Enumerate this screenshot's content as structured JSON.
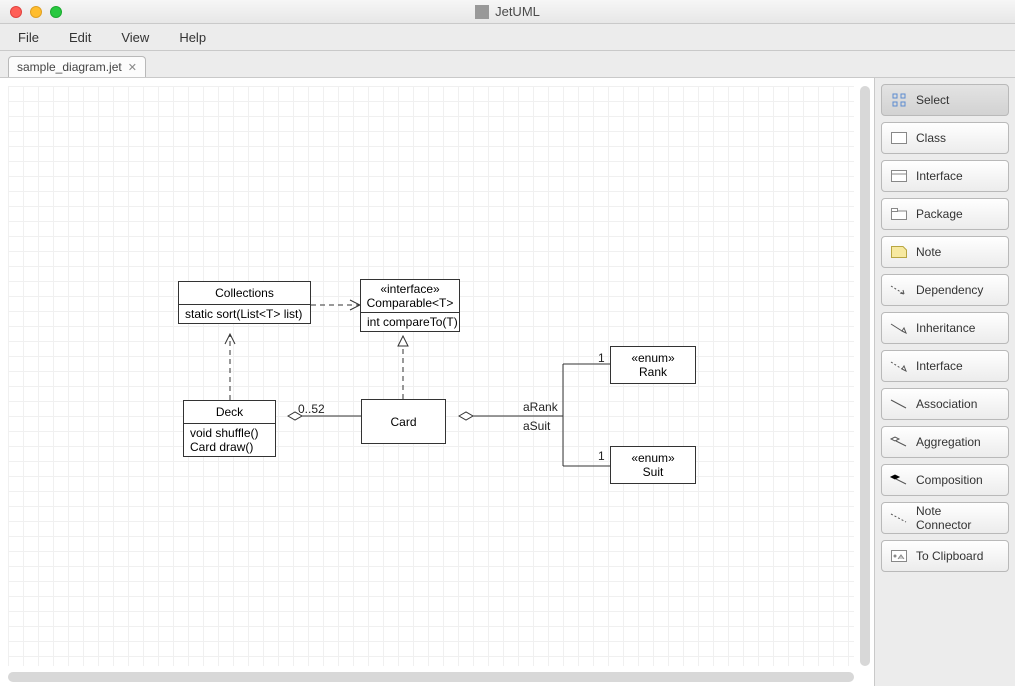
{
  "app_title": "JetUML",
  "menubar": {
    "file": "File",
    "edit": "Edit",
    "view": "View",
    "help": "Help"
  },
  "tab": {
    "label": "sample_diagram.jet",
    "close": "✕"
  },
  "nodes": {
    "collections": {
      "name": "Collections",
      "op": "static sort(List<T> list)"
    },
    "comparable": {
      "stereo": "«interface»",
      "name": "Comparable<T>",
      "op": "int compareTo(T)"
    },
    "deck": {
      "name": "Deck",
      "op1": "void shuffle()",
      "op2": "Card draw()"
    },
    "card": {
      "name": "Card"
    },
    "rank": {
      "stereo": "«enum»",
      "name": "Rank"
    },
    "suit": {
      "stereo": "«enum»",
      "name": "Suit"
    }
  },
  "edge_labels": {
    "multiplicity": "0..52",
    "rank_mult": "1",
    "suit_mult": "1",
    "aRank": "aRank",
    "aSuit": "aSuit"
  },
  "palette": {
    "select": "Select",
    "class": "Class",
    "interface": "Interface",
    "package": "Package",
    "note": "Note",
    "dependency": "Dependency",
    "inheritance": "Inheritance",
    "interface_conn": "Interface",
    "association": "Association",
    "aggregation": "Aggregation",
    "composition": "Composition",
    "note_conn": "Note Connector",
    "clipboard": "To Clipboard"
  }
}
